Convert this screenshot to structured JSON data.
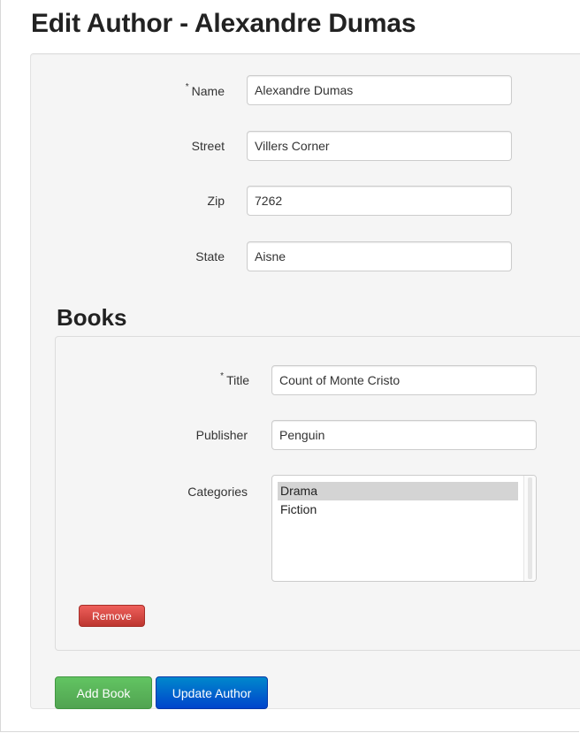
{
  "page": {
    "title": "Edit Author - Alexandre Dumas"
  },
  "author_form": {
    "required_marker": "*",
    "name": {
      "label": "Name",
      "value": "Alexandre Dumas"
    },
    "street": {
      "label": "Street",
      "value": "Villers Corner"
    },
    "zip": {
      "label": "Zip",
      "value": "7262"
    },
    "state": {
      "label": "State",
      "value": "Aisne"
    }
  },
  "books": {
    "heading": "Books",
    "items": [
      {
        "title": {
          "label": "Title",
          "value": "Count of Monte Cristo"
        },
        "publisher": {
          "label": "Publisher",
          "value": "Penguin"
        },
        "categories": {
          "label": "Categories",
          "options": [
            "Drama",
            "Fiction"
          ],
          "selected": "Drama"
        },
        "remove_label": "Remove"
      }
    ]
  },
  "actions": {
    "add_book_label": "Add Book",
    "update_author_label": "Update Author"
  },
  "colors": {
    "danger": "#d9534f",
    "success": "#5cb85c",
    "primary": "#0066cc",
    "well_bg": "#f5f5f5"
  }
}
